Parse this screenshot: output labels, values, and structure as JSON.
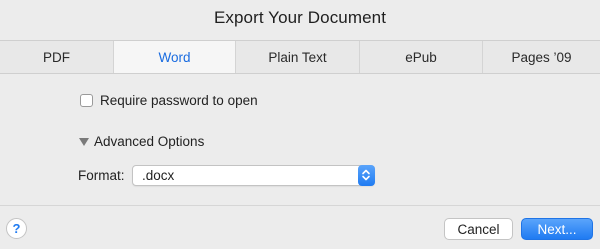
{
  "dialog": {
    "title": "Export Your Document"
  },
  "tabs": [
    {
      "label": "PDF",
      "active": false
    },
    {
      "label": "Word",
      "active": true
    },
    {
      "label": "Plain Text",
      "active": false
    },
    {
      "label": "ePub",
      "active": false
    },
    {
      "label": "Pages ’09",
      "active": false
    }
  ],
  "options": {
    "require_password_label": "Require password to open",
    "require_password_checked": false,
    "advanced_label": "Advanced Options",
    "format_label": "Format:",
    "format_value": ".docx"
  },
  "footer": {
    "help_label": "?",
    "cancel_label": "Cancel",
    "next_label": "Next..."
  },
  "colors": {
    "accent": "#1f7bf2",
    "active_tab_text": "#1a6ce0",
    "background": "#ececec"
  }
}
